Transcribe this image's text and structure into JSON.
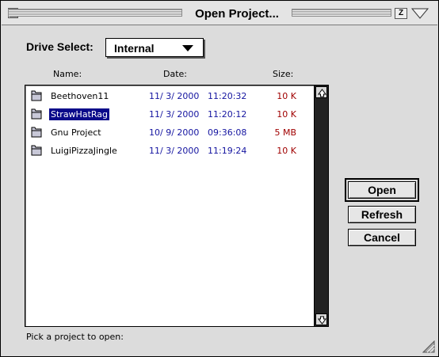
{
  "window": {
    "title": "Open Project..."
  },
  "title_bar": {
    "zoom_label": "Z"
  },
  "drive": {
    "label": "Drive Select:",
    "selected": "Internal"
  },
  "columns": {
    "name": "Name:",
    "date": "Date:",
    "size": "Size:"
  },
  "files": [
    {
      "name": "Beethoven11",
      "date": "11/ 3/ 2000",
      "time": "11:20:32",
      "size": "10 K",
      "selected": false
    },
    {
      "name": "StrawHatRag",
      "date": "11/ 3/ 2000",
      "time": "11:20:12",
      "size": "10 K",
      "selected": true
    },
    {
      "name": "Gnu Project",
      "date": "10/ 9/ 2000",
      "time": "09:36:08",
      "size": "5 MB",
      "selected": false
    },
    {
      "name": "LuigiPizzaJingle",
      "date": "11/ 3/ 2000",
      "time": "11:19:24",
      "size": "10 K",
      "selected": false
    }
  ],
  "buttons": {
    "open": "Open",
    "refresh": "Refresh",
    "cancel": "Cancel"
  },
  "status": "Pick a project to open:",
  "colors": {
    "selection": "#0a0a8a",
    "date_text": "#1414a0",
    "size_text": "#a00000"
  },
  "icons": {
    "file": "folder-icon",
    "scroll_up": "scroll-up-arrow-icon",
    "scroll_down": "scroll-down-arrow-icon"
  }
}
